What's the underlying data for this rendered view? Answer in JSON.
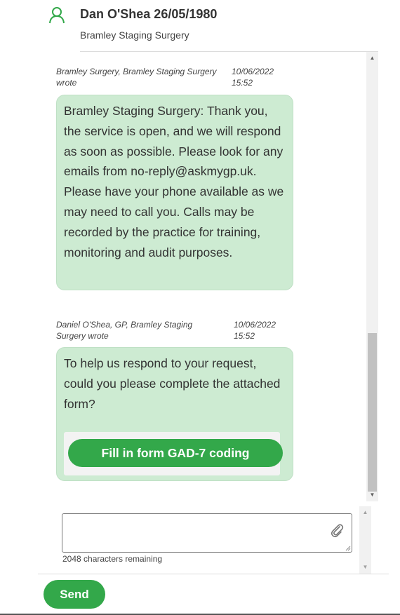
{
  "header": {
    "patient_name": "Dan O'Shea 26/05/1980",
    "practice_name": "Bramley Staging Surgery",
    "icon": "person-icon"
  },
  "messages": [
    {
      "author": "Bramley Surgery, Bramley Staging Surgery wrote",
      "date": "10/06/2022",
      "time": "15:52",
      "text": "Bramley Staging Surgery: Thank you, the service is open, and we will respond as soon as possible. Please look for any emails from no-reply@askmygp.uk. Please have your phone available as we may need to call you. Calls may be recorded by the practice for training, monitoring and audit purposes."
    },
    {
      "author": "Daniel O'Shea, GP, Bramley Staging Surgery wrote",
      "date": "10/06/2022",
      "time": "15:52",
      "text": "To help us respond to your request, could you please complete the attached form?",
      "form_button_label": "Fill in form GAD-7 coding"
    }
  ],
  "composer": {
    "value": "",
    "placeholder": "",
    "characters_remaining": "2048 characters remaining",
    "attach_icon": "paperclip-icon"
  },
  "send_label": "Send",
  "colors": {
    "accent": "#33a84a",
    "bubble": "#cdebd2"
  }
}
